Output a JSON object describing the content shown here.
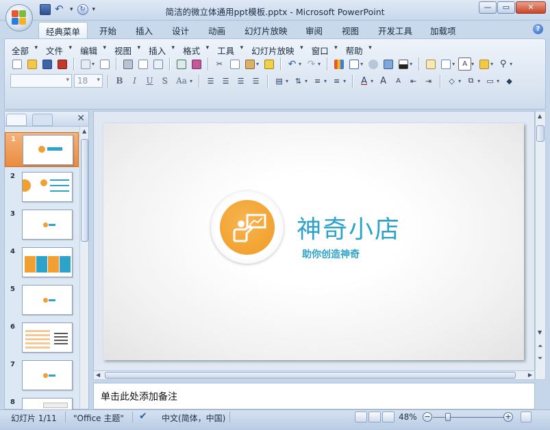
{
  "window": {
    "title": "简洁的微立体通用ppt模板.pptx - Microsoft PowerPoint",
    "controls": [
      "minimize",
      "maximize",
      "close"
    ]
  },
  "quick_access": [
    "save-icon",
    "undo-icon",
    "redo-icon"
  ],
  "ribbon_tabs": [
    {
      "label": "经典菜单",
      "active": true
    },
    {
      "label": "开始"
    },
    {
      "label": "插入"
    },
    {
      "label": "设计"
    },
    {
      "label": "动画"
    },
    {
      "label": "幻灯片放映"
    },
    {
      "label": "审阅"
    },
    {
      "label": "视图"
    },
    {
      "label": "开发工具"
    },
    {
      "label": "加载项"
    }
  ],
  "classic_menu": [
    "全部",
    "文件",
    "编辑",
    "视图",
    "插入",
    "格式",
    "工具",
    "幻灯片放映",
    "窗口",
    "帮助"
  ],
  "font_box": {
    "font": "",
    "size": "18"
  },
  "format_buttons": [
    "B",
    "I",
    "U",
    "S",
    "Aa"
  ],
  "slide_panel": {
    "selected": 1,
    "thumbnails": [
      "1",
      "2",
      "3",
      "4",
      "5",
      "6",
      "7",
      "8"
    ]
  },
  "slide": {
    "title": "神奇小店",
    "subtitle": "助你创造神奇",
    "colors": {
      "accent": "#2ea3c9",
      "logo": "#f0a033"
    }
  },
  "notes": {
    "placeholder": "单击此处添加备注"
  },
  "status": {
    "slide_info": "幻灯片 1/11",
    "theme": "\"Office 主题\"",
    "language": "中文(简体，中国)",
    "zoom": "48%",
    "zoom_value": 48
  }
}
